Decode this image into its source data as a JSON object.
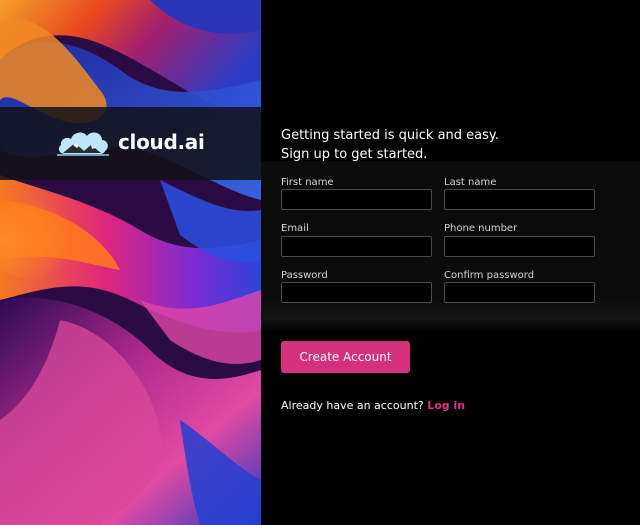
{
  "brand": {
    "name": "cloud.ai",
    "logo_icon": "cloud-icon"
  },
  "intro": {
    "line1": "Getting started is quick and easy.",
    "line2": "Sign up to get started."
  },
  "form": {
    "first_name": {
      "label": "First name",
      "value": ""
    },
    "last_name": {
      "label": "Last name",
      "value": ""
    },
    "email": {
      "label": "Email",
      "value": ""
    },
    "phone": {
      "label": "Phone number",
      "value": ""
    },
    "password": {
      "label": "Password",
      "value": ""
    },
    "confirm_password": {
      "label": "Confirm password",
      "value": ""
    }
  },
  "actions": {
    "create_account_label": "Create Account"
  },
  "login": {
    "prompt": "Already have an account?",
    "link_label": "Log in"
  },
  "colors": {
    "accent": "#d6307c",
    "link": "#e0338a",
    "background": "#000000"
  }
}
